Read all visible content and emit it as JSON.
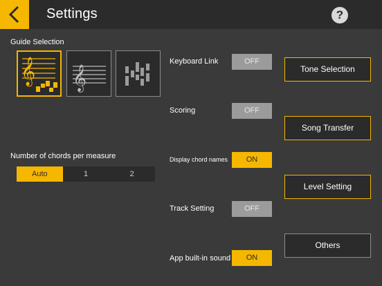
{
  "header": {
    "title": "Settings",
    "back_icon": "chevron-left-icon",
    "help_label": "?"
  },
  "guide_selection": {
    "label": "Guide Selection",
    "options": [
      {
        "icon": "staff-with-bars-icon",
        "selected": true
      },
      {
        "icon": "staff-icon",
        "selected": false
      },
      {
        "icon": "bars-only-icon",
        "selected": false
      }
    ]
  },
  "chords_per_measure": {
    "label": "Number of chords per measure",
    "options": [
      "Auto",
      "1",
      "2"
    ],
    "selected": "Auto"
  },
  "toggles": [
    {
      "label": "Keyboard Link",
      "value": "OFF"
    },
    {
      "label": "Scoring",
      "value": "OFF"
    },
    {
      "label": "Display chord names",
      "value": "ON"
    },
    {
      "label": "Track Setting",
      "value": "OFF"
    },
    {
      "label": "App built-in sound",
      "value": "ON"
    }
  ],
  "menu_buttons": [
    "Tone Selection",
    "Song Transfer",
    "Level Setting",
    "Others"
  ],
  "colors": {
    "accent": "#f5b700",
    "background": "#3a3a3a",
    "header": "#2b2b2b",
    "toggle_off": "#9b9b9b"
  }
}
